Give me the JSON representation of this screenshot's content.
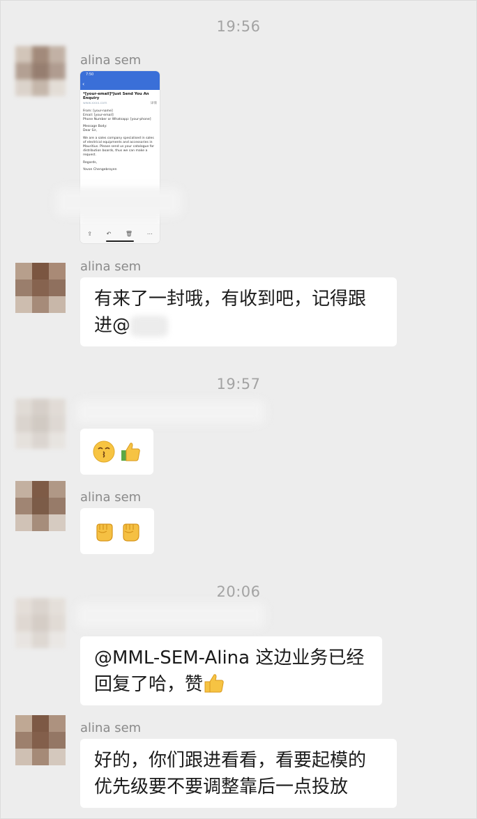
{
  "timestamps": [
    "19:56",
    "19:57",
    "20:06"
  ],
  "sender_name": "alina sem",
  "screenshot_message": {
    "status_time": "7:50",
    "subject": "*[your-email]*Just Send You An Enquiry",
    "site": "www.xxxx.com",
    "detail": "详情",
    "from": "From: [your-name]",
    "email": "Email: [your-email]",
    "phone": "Phone Number or Whatsapp: [your-phone]",
    "body_label": "Message Body:",
    "greeting": "Dear Sir,",
    "body": "We are a sales company specialised in sales of electrical equipments and accessories in Mauritius. Please send us your catalogue for distribution boards, thus we can make a request.",
    "regards": "Regards,",
    "signature": "Yovon Chengebroyen"
  },
  "messages": {
    "m1_text": "有来了一封哦，有收到吧，记得跟进@",
    "m2_text": "",
    "m4_text": "@MML-SEM-Alina 这边业务已经回复了哈，赞",
    "m5_text": "好的，你们跟进看看，看要起模的优先级要不要调整靠后一点投放"
  },
  "emoji_names": {
    "m2": [
      "kissing-face-icon",
      "thumbs-up-icon"
    ],
    "m3": [
      "raised-fist-icon",
      "raised-fist-icon"
    ],
    "m4": [
      "thumbs-up-icon"
    ]
  },
  "colors": {
    "background": "#ededed",
    "bubble": "#ffffff",
    "timestamp": "#a3a3a3",
    "name": "#8a8a8a",
    "email_header": "#3a6fd8"
  }
}
